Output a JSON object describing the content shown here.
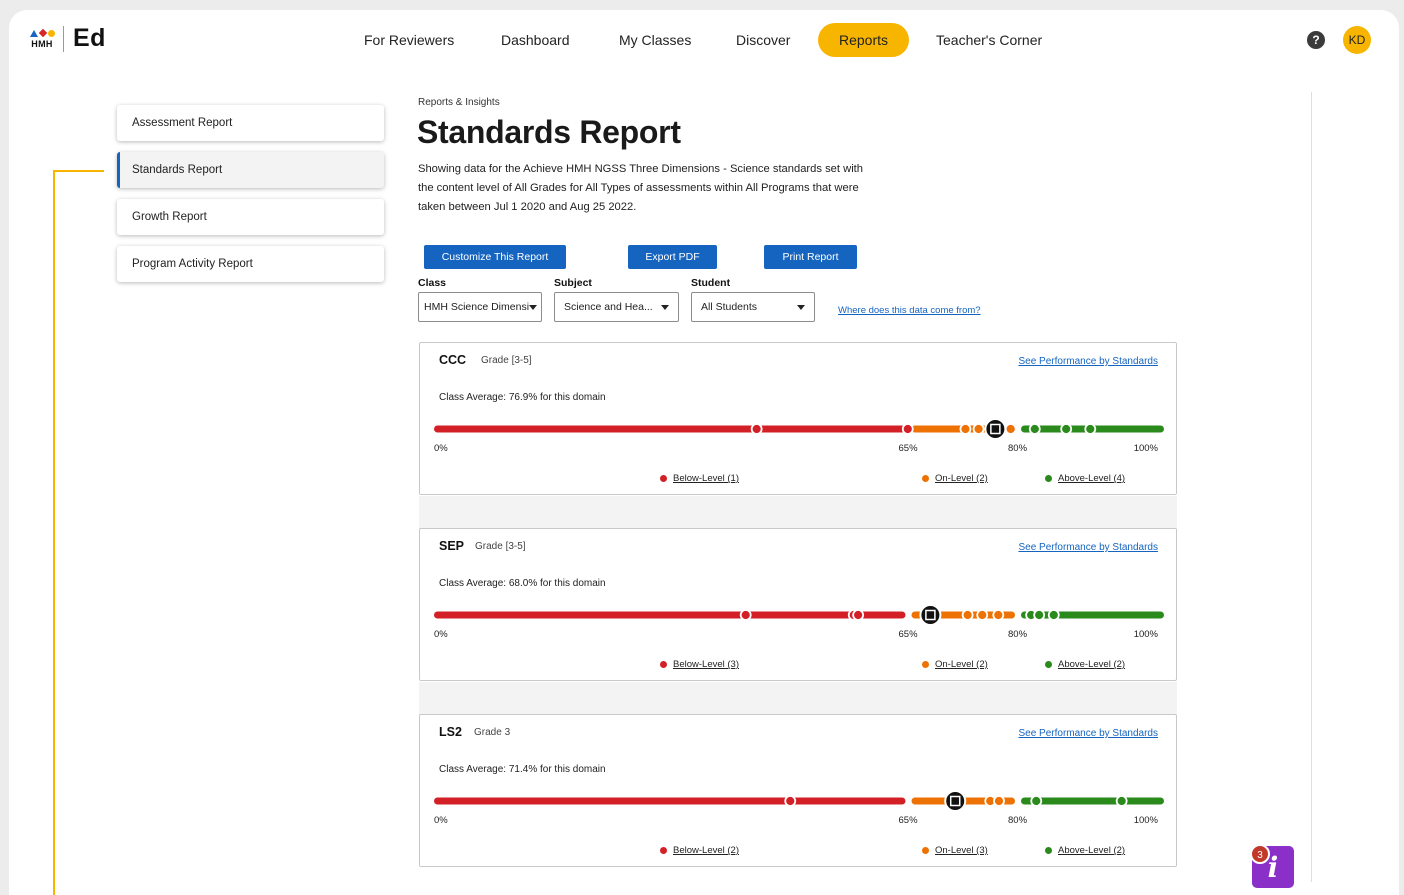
{
  "brand": {
    "mark_word": "HMH",
    "product": "Ed"
  },
  "nav": {
    "items": [
      "For Reviewers",
      "Dashboard",
      "My Classes",
      "Discover",
      "Reports",
      "Teacher's Corner"
    ],
    "active": "Reports",
    "help_icon": "?",
    "avatar_initials": "KD"
  },
  "sidebar": {
    "items": [
      "Assessment Report",
      "Standards Report",
      "Growth Report",
      "Program Activity Report"
    ],
    "active": "Standards Report"
  },
  "main": {
    "breadcrumb": "Reports & Insights",
    "title": "Standards Report",
    "description": "Showing data for the Achieve HMH NGSS Three Dimensions - Science standards set with the content level of All Grades for All Types of assessments within All Programs that were taken between Jul 1 2020 and Aug 25 2022.",
    "buttons": {
      "customize": "Customize This Report",
      "export": "Export PDF",
      "print": "Print Report"
    },
    "filters": {
      "class_label": "Class",
      "class_value": "HMH Science Dimensi",
      "subject_label": "Subject",
      "subject_value": "Science and Hea...",
      "student_label": "Student",
      "student_value": "All Students"
    },
    "data_link": "Where does this data come from?"
  },
  "colors": {
    "below": "#d32027",
    "on": "#ee7203",
    "above": "#2a8a1b",
    "accent": "#1565c0",
    "highlight": "#f7b500"
  },
  "domains": [
    {
      "code": "CCC",
      "grade": "Grade [3-5]",
      "link": "See Performance by Standards",
      "average_text": "Class Average: 76.9% for this domain",
      "class_average": 76.9,
      "ticks": [
        "0%",
        "65%",
        "80%",
        "100%"
      ],
      "students": [
        44.2,
        64.9,
        72.8,
        74.6,
        79.0,
        82.3,
        86.6,
        89.9
      ],
      "legend": {
        "below": "Below-Level (1)",
        "on": "On-Level (2)",
        "above": "Above-Level (4)"
      }
    },
    {
      "code": "SEP",
      "grade": "Grade [3-5]",
      "link": "See Performance by Standards",
      "average_text": "Class Average: 68.0% for this domain",
      "class_average": 68.0,
      "ticks": [
        "0%",
        "65%",
        "80%",
        "100%"
      ],
      "students": [
        42.7,
        57.5,
        58.1,
        73.1,
        75.1,
        77.3,
        81.8,
        82.9,
        84.9
      ],
      "legend": {
        "below": "Below-Level (3)",
        "on": "On-Level (2)",
        "above": "Above-Level (2)"
      }
    },
    {
      "code": "LS2",
      "grade": "Grade 3",
      "link": "See Performance by Standards",
      "average_text": "Class Average: 71.4% for this domain",
      "class_average": 71.4,
      "ticks": [
        "0%",
        "65%",
        "80%",
        "100%"
      ],
      "students": [
        48.8,
        76.2,
        77.4,
        82.5,
        94.2
      ],
      "legend": {
        "below": "Below-Level (2)",
        "on": "On-Level (3)",
        "above": "Above-Level (2)"
      }
    }
  ],
  "help_widget": {
    "badge_count": "3",
    "icon": "i"
  }
}
